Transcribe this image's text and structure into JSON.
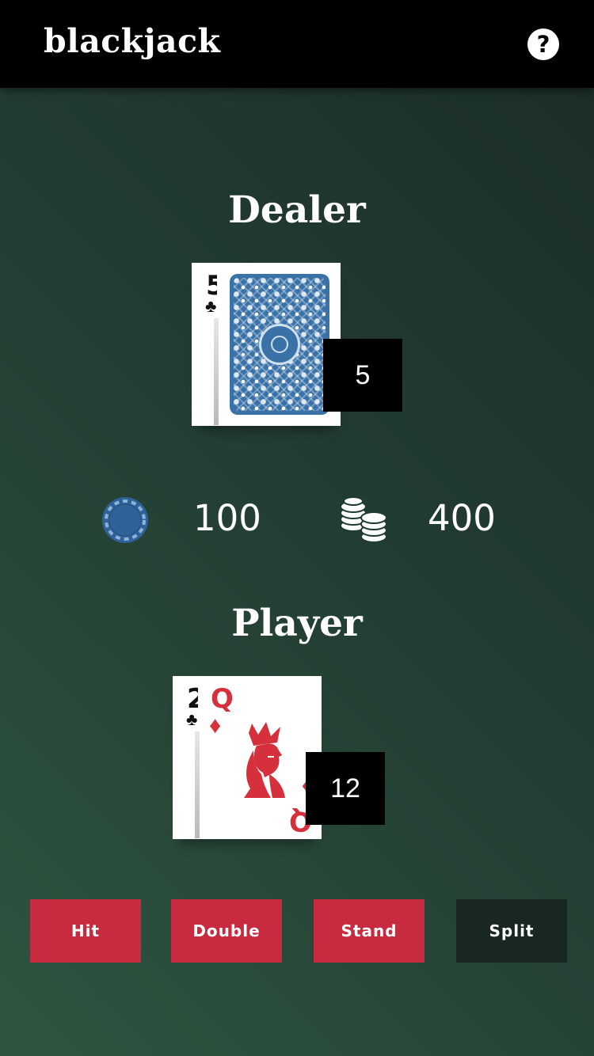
{
  "app": {
    "title": "blackjack",
    "help_icon": "question-circle-icon",
    "help_glyph": "?"
  },
  "dealer": {
    "title": "Dealer",
    "score": "5",
    "cards": [
      {
        "rank": "5",
        "suit": "♣",
        "suit_name": "clubs",
        "face_up": true
      },
      {
        "face_up": false
      }
    ]
  },
  "bank": {
    "bet": {
      "icon": "chip-icon",
      "value": "100"
    },
    "balance": {
      "icon": "chip-stack-icon",
      "value": "400"
    }
  },
  "player": {
    "title": "Player",
    "score": "12",
    "cards": [
      {
        "rank": "2",
        "suit": "♣",
        "suit_name": "clubs",
        "face_up": true
      },
      {
        "rank": "Q",
        "suit": "♦",
        "suit_name": "diamonds",
        "face_up": true
      }
    ]
  },
  "actions": {
    "hit": "Hit",
    "double": "Double",
    "stand": "Stand",
    "split": "Split"
  },
  "colors": {
    "action_red": "#c82a3f",
    "split_dark": "#182624",
    "card_back_blue": "#3a72a8",
    "chip_blue": "#2e6299",
    "diamond_red": "#d7303d"
  }
}
